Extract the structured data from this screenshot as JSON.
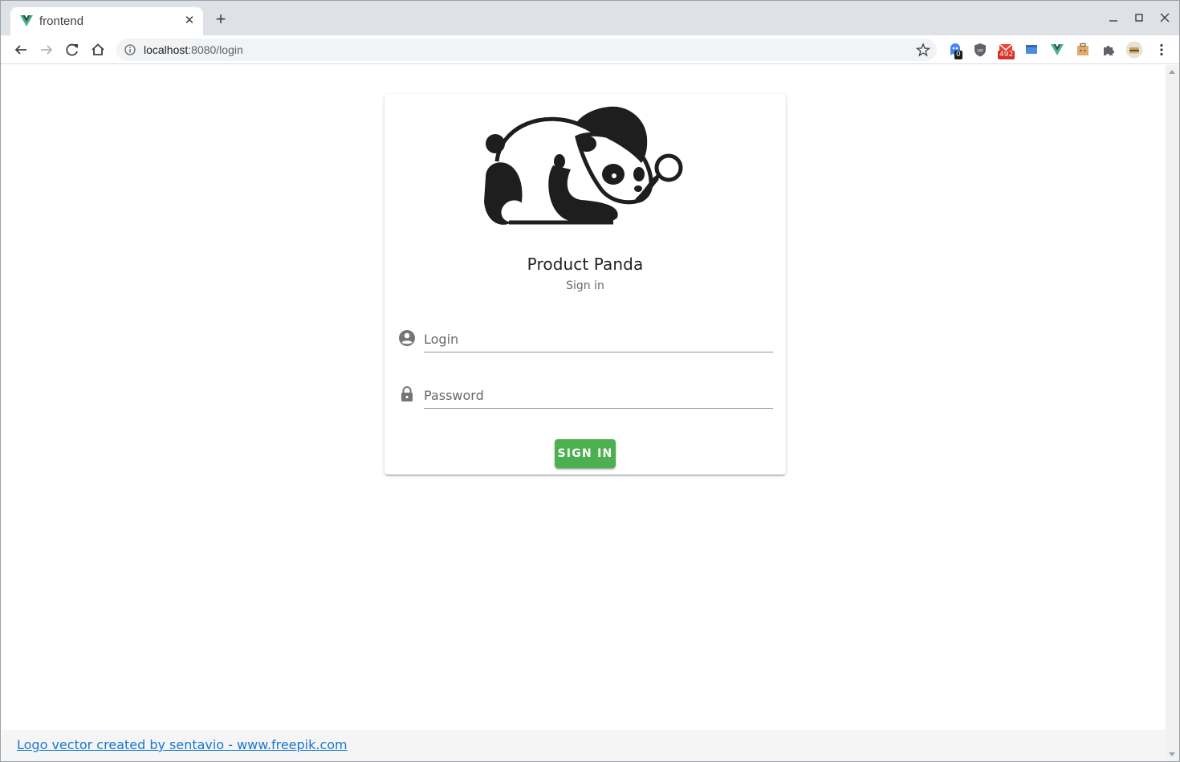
{
  "browser": {
    "tab_title": "frontend",
    "url_host": "localhost",
    "url_rest": ":8080/login",
    "extensions": [
      {
        "name": "ext-ghost",
        "badge": "0"
      },
      {
        "name": "ext-ublock",
        "badge": ""
      },
      {
        "name": "ext-mail",
        "badge": "492"
      },
      {
        "name": "ext-window",
        "badge": ""
      },
      {
        "name": "ext-vue-devtools",
        "badge": ""
      },
      {
        "name": "ext-toolbox",
        "badge": ""
      },
      {
        "name": "ext-puzzle",
        "badge": ""
      },
      {
        "name": "ext-profile",
        "badge": ""
      }
    ]
  },
  "login_card": {
    "title": "Product Panda",
    "subtitle": "Sign in",
    "login_placeholder": "Login",
    "password_placeholder": "Password",
    "signin_label": "SIGN IN"
  },
  "footer": {
    "credit_link": "Logo vector created by sentavio - www.freepik.com"
  },
  "colors": {
    "primary_button": "#4caf50",
    "link": "#1976d2",
    "vue_green": "#42b883"
  }
}
